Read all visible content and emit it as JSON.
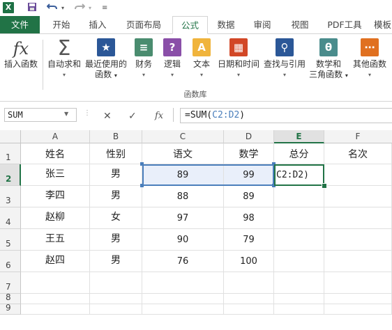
{
  "titlebar": {
    "app_icon": "X",
    "save_icon": "save-icon",
    "undo_icon": "undo-icon",
    "redo_icon": "redo-icon"
  },
  "tabs": [
    {
      "label": "文件",
      "name": "tab-file"
    },
    {
      "label": "开始",
      "name": "tab-home"
    },
    {
      "label": "插入",
      "name": "tab-insert"
    },
    {
      "label": "页面布局",
      "name": "tab-page-layout"
    },
    {
      "label": "公式",
      "name": "tab-formulas"
    },
    {
      "label": "数据",
      "name": "tab-data"
    },
    {
      "label": "审阅",
      "name": "tab-review"
    },
    {
      "label": "视图",
      "name": "tab-view"
    },
    {
      "label": "PDF工具",
      "name": "tab-pdf-tools"
    },
    {
      "label": "模板",
      "name": "tab-templates"
    }
  ],
  "ribbon": {
    "insert_function": {
      "glyph": "fx",
      "label": "插入函数"
    },
    "autosum": {
      "glyph": "Σ",
      "label": "自动求和"
    },
    "recent": {
      "label_1": "最近使用的",
      "label_2": "函数"
    },
    "financial": {
      "label": "财务"
    },
    "logical": {
      "label": "逻辑"
    },
    "text": {
      "label": "文本"
    },
    "datetime": {
      "label": "日期和时间"
    },
    "lookup": {
      "label": "查找与引用"
    },
    "math": {
      "label_1": "数学和",
      "label_2": "三角函数"
    },
    "other": {
      "label": "其他函数"
    },
    "group_label": "函数库"
  },
  "formula_bar": {
    "name_box": "SUM",
    "fx_label": "fx",
    "formula_prefix": "=SUM(",
    "formula_ref": "C2:D2",
    "formula_suffix": ")"
  },
  "columns": [
    "A",
    "B",
    "C",
    "D",
    "E",
    "F"
  ],
  "rows": [
    "1",
    "2",
    "3",
    "4",
    "5",
    "6",
    "7",
    "8",
    "9"
  ],
  "sheet": {
    "header": [
      "姓名",
      "性别",
      "语文",
      "数学",
      "总分",
      "名次"
    ],
    "data": [
      [
        "张三",
        "男",
        "89",
        "99",
        "C2:D2)",
        ""
      ],
      [
        "李四",
        "男",
        "88",
        "89",
        "",
        ""
      ],
      [
        "赵柳",
        "女",
        "97",
        "98",
        "",
        ""
      ],
      [
        "王五",
        "男",
        "90",
        "79",
        "",
        ""
      ],
      [
        "赵四",
        "男",
        "76",
        "100",
        "",
        ""
      ]
    ]
  },
  "colors": {
    "accent": "#217346",
    "selection_blue": "#4a7ebb"
  }
}
